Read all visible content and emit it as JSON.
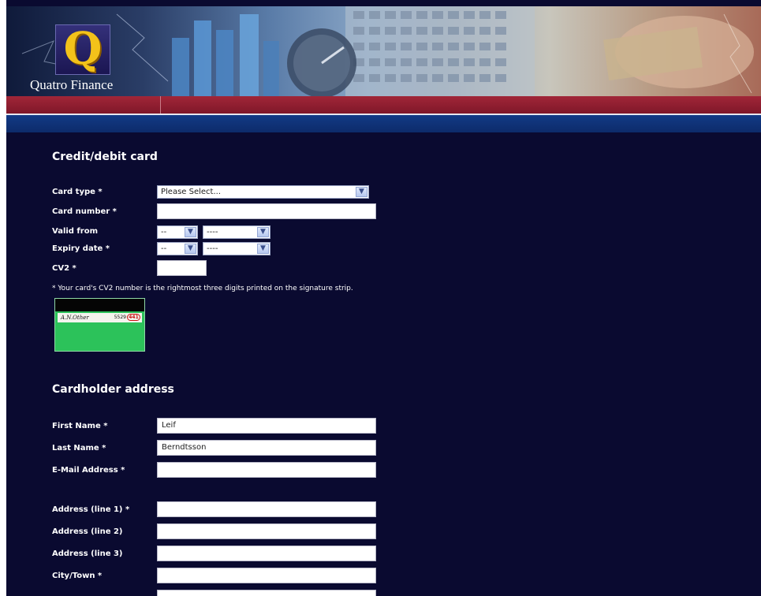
{
  "header": {
    "logo_letter": "Q",
    "company_name": "Quatro Finance"
  },
  "card_section": {
    "title": "Credit/debit card",
    "card_type_label": "Card type *",
    "card_type_value": "Please Select...",
    "card_number_label": "Card number *",
    "card_number_value": "",
    "valid_from_label": "Valid from",
    "valid_from_month": "--",
    "valid_from_year": "----",
    "expiry_label": "Expiry date *",
    "expiry_month": "--",
    "expiry_year": "----",
    "cv2_label": "CV2 *",
    "cv2_value": "",
    "cv2_note": "* Your card's CV2 number is the rightmost three digits printed on the signature strip.",
    "card_sig_name": "A.N.Other",
    "card_sig_digits": "5529",
    "card_cv2_digits": "441"
  },
  "address_section": {
    "title": "Cardholder address",
    "first_name_label": "First Name *",
    "first_name_value": "Leif",
    "last_name_label": "Last Name *",
    "last_name_value": "Berndtsson",
    "email_label": "E-Mail Address *",
    "email_value": "",
    "address1_label": "Address (line 1) *",
    "address1_value": "",
    "address2_label": "Address (line 2)",
    "address2_value": "",
    "address3_label": "Address (line 3)",
    "address3_value": "",
    "city_label": "City/Town *",
    "city_value": "",
    "county_label": "",
    "county_value": ""
  },
  "colors": {
    "page_background": "#0a0a30",
    "red_band": "#a12638",
    "blue_band": "#123a86",
    "logo_gold": "#f3c21a"
  },
  "icons": [
    "dropdown-arrow-icon",
    "cv2-card-illustration"
  ]
}
